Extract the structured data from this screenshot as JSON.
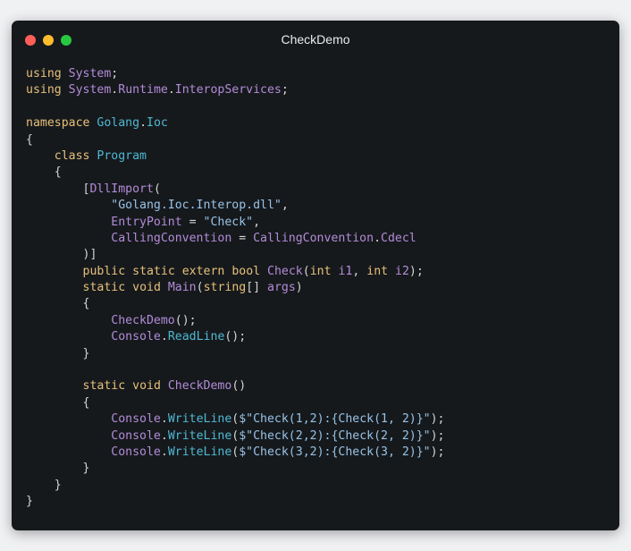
{
  "window": {
    "title": "CheckDemo",
    "colors": {
      "background": "#16191c",
      "close": "#ff5f57",
      "minimize": "#febc2e",
      "maximize": "#28c840"
    }
  },
  "code": {
    "lines": [
      [
        [
          "kw",
          "using"
        ],
        [
          "pl",
          " "
        ],
        [
          "ty",
          "System"
        ],
        [
          "pl",
          ";"
        ]
      ],
      [
        [
          "kw",
          "using"
        ],
        [
          "pl",
          " "
        ],
        [
          "ty",
          "System"
        ],
        [
          "pl",
          "."
        ],
        [
          "ty",
          "Runtime"
        ],
        [
          "pl",
          "."
        ],
        [
          "ty",
          "InteropServices"
        ],
        [
          "pl",
          ";"
        ]
      ],
      [],
      [
        [
          "kw",
          "namespace"
        ],
        [
          "pl",
          " "
        ],
        [
          "fn",
          "Golang"
        ],
        [
          "pl",
          "."
        ],
        [
          "fn",
          "Ioc"
        ]
      ],
      [
        [
          "pl",
          "{"
        ]
      ],
      [
        [
          "pl",
          "    "
        ],
        [
          "kw",
          "class"
        ],
        [
          "pl",
          " "
        ],
        [
          "fn",
          "Program"
        ]
      ],
      [
        [
          "pl",
          "    {"
        ]
      ],
      [
        [
          "pl",
          "        ["
        ],
        [
          "ty",
          "DllImport"
        ],
        [
          "pl",
          "("
        ]
      ],
      [
        [
          "pl",
          "            "
        ],
        [
          "st",
          "\"Golang.Ioc.Interop.dll\""
        ],
        [
          "pl",
          ","
        ]
      ],
      [
        [
          "pl",
          "            "
        ],
        [
          "ty",
          "EntryPoint"
        ],
        [
          "pl",
          " = "
        ],
        [
          "st",
          "\"Check\""
        ],
        [
          "pl",
          ","
        ]
      ],
      [
        [
          "pl",
          "            "
        ],
        [
          "ty",
          "CallingConvention"
        ],
        [
          "pl",
          " = "
        ],
        [
          "ty",
          "CallingConvention"
        ],
        [
          "pl",
          "."
        ],
        [
          "ty",
          "Cdecl"
        ]
      ],
      [
        [
          "pl",
          "        )]"
        ]
      ],
      [
        [
          "pl",
          "        "
        ],
        [
          "kw",
          "public"
        ],
        [
          "pl",
          " "
        ],
        [
          "kw",
          "static"
        ],
        [
          "pl",
          " "
        ],
        [
          "kw",
          "extern"
        ],
        [
          "pl",
          " "
        ],
        [
          "kw",
          "bool"
        ],
        [
          "pl",
          " "
        ],
        [
          "ty",
          "Check"
        ],
        [
          "pl",
          "("
        ],
        [
          "kw",
          "int"
        ],
        [
          "pl",
          " "
        ],
        [
          "ty",
          "i1"
        ],
        [
          "pl",
          ", "
        ],
        [
          "kw",
          "int"
        ],
        [
          "pl",
          " "
        ],
        [
          "ty",
          "i2"
        ],
        [
          "pl",
          ");"
        ]
      ],
      [
        [
          "pl",
          "        "
        ],
        [
          "kw",
          "static"
        ],
        [
          "pl",
          " "
        ],
        [
          "kw",
          "void"
        ],
        [
          "pl",
          " "
        ],
        [
          "ty",
          "Main"
        ],
        [
          "pl",
          "("
        ],
        [
          "kw",
          "string"
        ],
        [
          "pl",
          "[] "
        ],
        [
          "ty",
          "args"
        ],
        [
          "pl",
          ")"
        ]
      ],
      [
        [
          "pl",
          "        {"
        ]
      ],
      [
        [
          "pl",
          "            "
        ],
        [
          "ty",
          "CheckDemo"
        ],
        [
          "pl",
          "();"
        ]
      ],
      [
        [
          "pl",
          "            "
        ],
        [
          "ty",
          "Console"
        ],
        [
          "pl",
          "."
        ],
        [
          "fn",
          "ReadLine"
        ],
        [
          "pl",
          "();"
        ]
      ],
      [
        [
          "pl",
          "        }"
        ]
      ],
      [],
      [
        [
          "pl",
          "        "
        ],
        [
          "kw",
          "static"
        ],
        [
          "pl",
          " "
        ],
        [
          "kw",
          "void"
        ],
        [
          "pl",
          " "
        ],
        [
          "ty",
          "CheckDemo"
        ],
        [
          "pl",
          "()"
        ]
      ],
      [
        [
          "pl",
          "        {"
        ]
      ],
      [
        [
          "pl",
          "            "
        ],
        [
          "ty",
          "Console"
        ],
        [
          "pl",
          "."
        ],
        [
          "fn",
          "WriteLine"
        ],
        [
          "pl",
          "("
        ],
        [
          "st",
          "$\"Check(1,2):{Check(1, 2)}\""
        ],
        [
          "pl",
          ");"
        ]
      ],
      [
        [
          "pl",
          "            "
        ],
        [
          "ty",
          "Console"
        ],
        [
          "pl",
          "."
        ],
        [
          "fn",
          "WriteLine"
        ],
        [
          "pl",
          "("
        ],
        [
          "st",
          "$\"Check(2,2):{Check(2, 2)}\""
        ],
        [
          "pl",
          ");"
        ]
      ],
      [
        [
          "pl",
          "            "
        ],
        [
          "ty",
          "Console"
        ],
        [
          "pl",
          "."
        ],
        [
          "fn",
          "WriteLine"
        ],
        [
          "pl",
          "("
        ],
        [
          "st",
          "$\"Check(3,2):{Check(3, 2)}\""
        ],
        [
          "pl",
          ");"
        ]
      ],
      [
        [
          "pl",
          "        }"
        ]
      ],
      [
        [
          "pl",
          "    }"
        ]
      ],
      [
        [
          "pl",
          "}"
        ]
      ]
    ]
  }
}
